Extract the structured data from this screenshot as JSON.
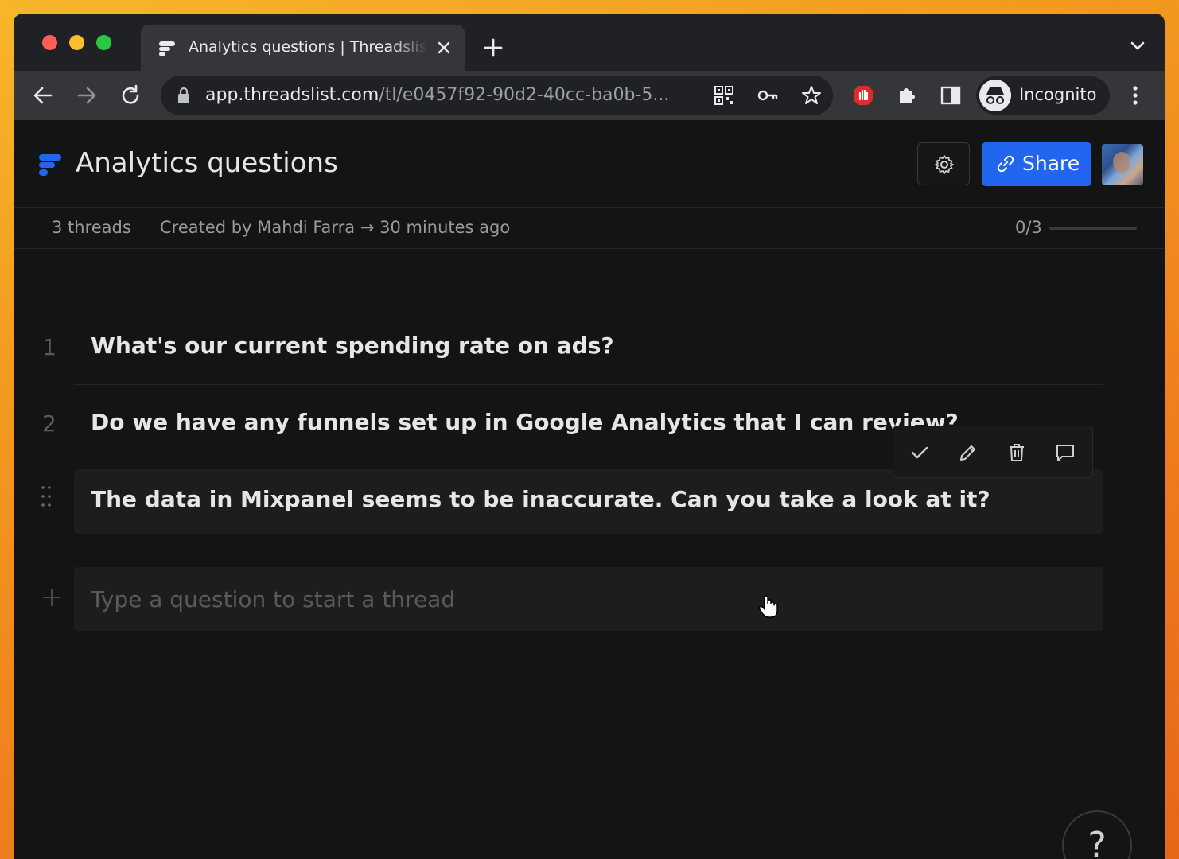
{
  "browser": {
    "tab": {
      "title": "Analytics questions | Threadslist"
    },
    "address": {
      "host": "app.threadslist.com",
      "path": "/tl/e0457f92-90d2-40cc-ba0b-5..."
    },
    "profile_label": "Incognito"
  },
  "header": {
    "title": "Analytics questions",
    "share_label": "Share"
  },
  "meta": {
    "thread_count": "3 threads",
    "created": "Created by Mahdi Farra → 30 minutes ago",
    "progress_text": "0/3",
    "progress_fraction": 0
  },
  "threads": [
    {
      "num": "1",
      "text": "What's our current spending rate on ads?"
    },
    {
      "num": "2",
      "text": "Do we have any funnels set up in Google Analytics that I can review?"
    },
    {
      "num": "",
      "text": "The data in Mixpanel seems to be inaccurate. Can you take a look at it?"
    }
  ],
  "new_thread": {
    "placeholder": "Type a question to start a thread"
  },
  "help_label": "?",
  "colors": {
    "accent": "#2266f0",
    "background": "#141414",
    "browser_chrome": "#35363a"
  },
  "icons": {
    "thread_actions": [
      "check-icon",
      "pencil-icon",
      "trash-icon",
      "comment-icon"
    ]
  }
}
